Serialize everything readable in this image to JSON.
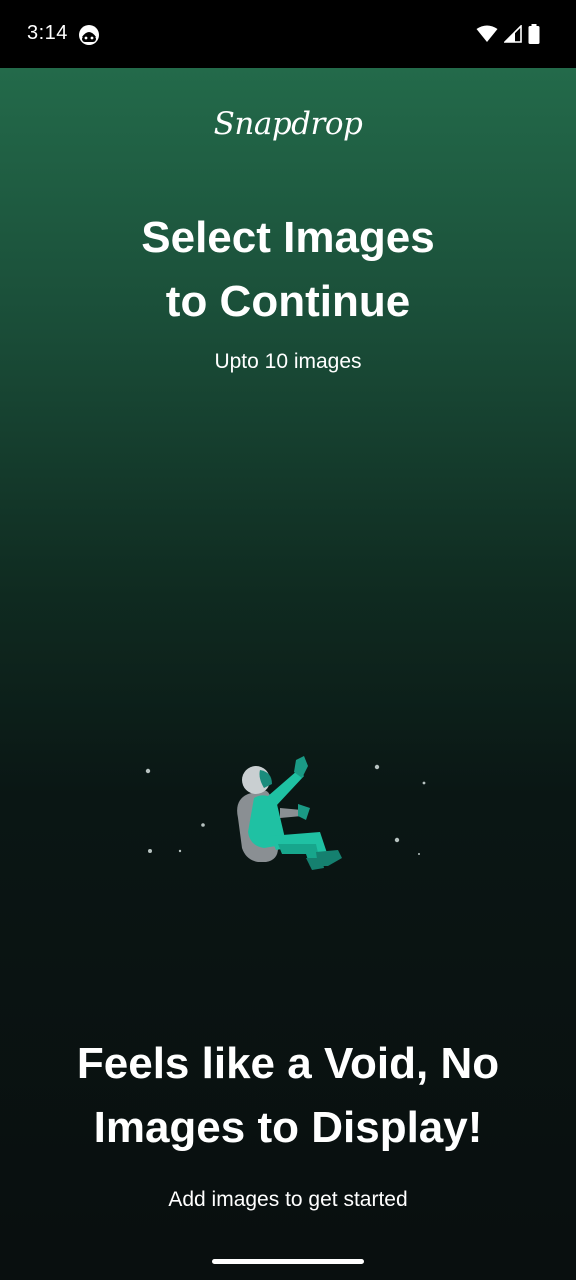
{
  "status_bar": {
    "time": "3:14",
    "app_icon": "android-face-icon",
    "indicators": [
      "wifi-icon",
      "cellular-signal-icon",
      "battery-icon"
    ]
  },
  "app": {
    "brand": "Snapdrop",
    "title_line1": "Select Images",
    "title_line2": "to Continue",
    "subtitle": "Upto 10 images"
  },
  "empty_state": {
    "illustration": "floating-astronaut-illustration",
    "title_line1": "Feels like a Void, No",
    "title_line2": "Images to Display!",
    "subtitle": "Add images to get started"
  },
  "colors": {
    "gradient_top": "#236a4a",
    "gradient_bottom": "#090f0f",
    "astronaut_suit": "#1fc1a3",
    "astronaut_backpack": "#8a8f93"
  },
  "nav_bar": {
    "home_indicator": "home-gesture-bar"
  }
}
